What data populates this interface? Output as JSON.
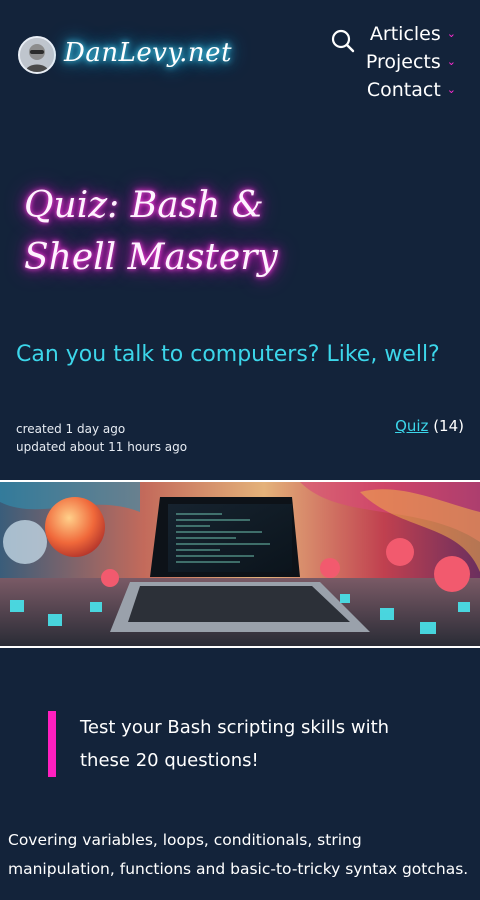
{
  "header": {
    "logo_text": "DanLevy.net",
    "nav": [
      {
        "label": "Articles"
      },
      {
        "label": "Projects"
      },
      {
        "label": "Contact"
      }
    ]
  },
  "article": {
    "title_line1": "Quiz: Bash &",
    "title_line2": "Shell Mastery",
    "subtitle": "Can you talk to computers? Like, well?",
    "created": "created 1 day ago",
    "updated": "updated about 11 hours ago",
    "category_label": "Quiz",
    "category_count": "(14)",
    "callout_line1": "Test your Bash scripting skills with",
    "callout_line2": "these 20 questions!",
    "body": "Covering variables, loops, conditionals, string manipulation, functions and basic-to-tricky syntax gotchas."
  },
  "colors": {
    "background": "#13233a",
    "accent_cyan": "#3cd6ea",
    "accent_magenta": "#ff1fbf"
  }
}
